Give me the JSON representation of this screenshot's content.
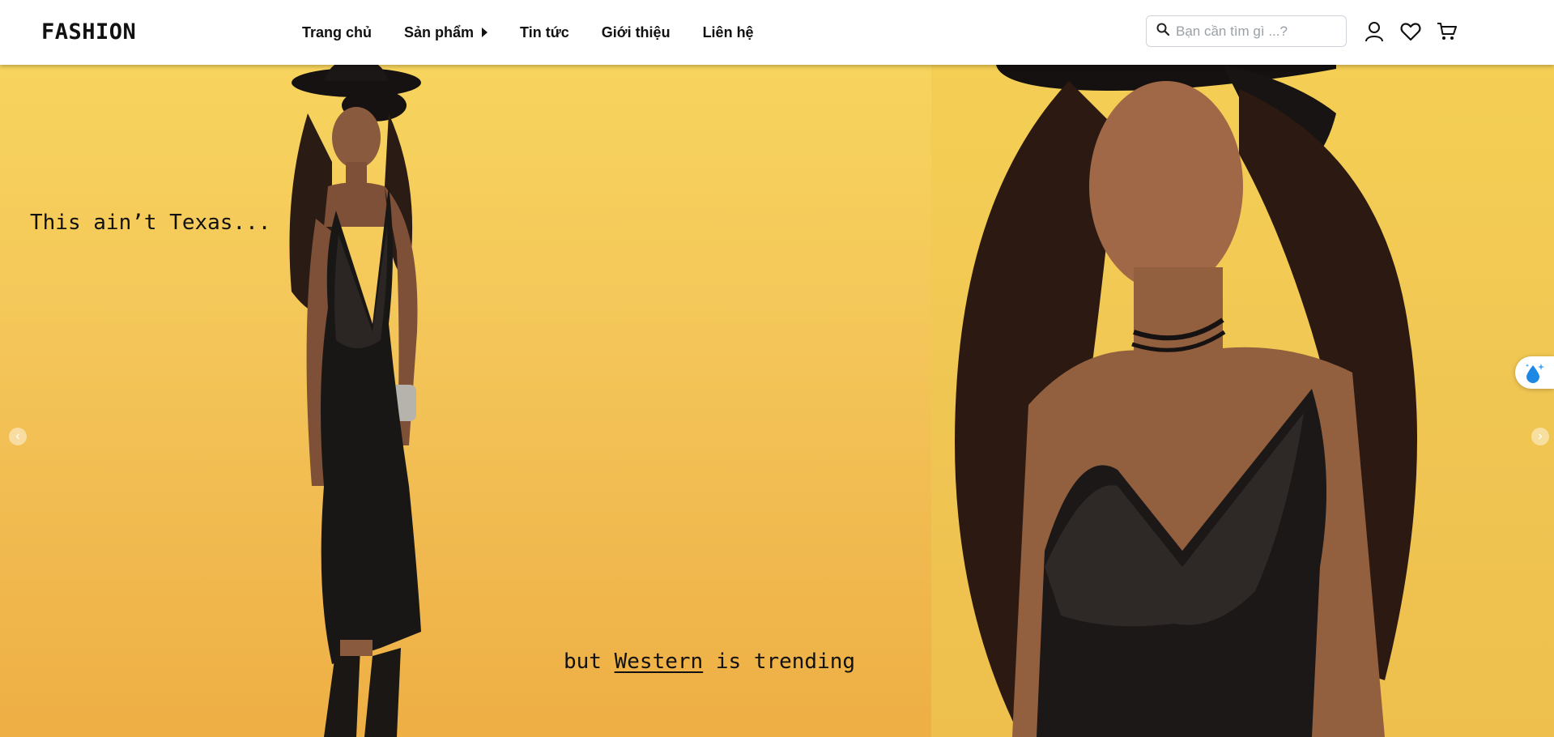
{
  "header": {
    "logo": "FASHION",
    "nav": [
      {
        "label": "Trang chủ"
      },
      {
        "label": "Sản phẩm"
      },
      {
        "label": "Tin tức"
      },
      {
        "label": "Giới thiệu"
      },
      {
        "label": "Liên hệ"
      }
    ],
    "search": {
      "placeholder": "Bạn cần tìm gì ...?",
      "value": ""
    },
    "icons": [
      "search-icon",
      "user-icon",
      "heart-icon",
      "cart-icon"
    ]
  },
  "banner": {
    "caption_top": "This ain’t Texas...",
    "caption_bottom_pre": "but ",
    "caption_bottom_link": "Western",
    "caption_bottom_post": " is trending",
    "prev_arrow": "‹",
    "next_arrow": "›"
  },
  "colors": {
    "background_yellow": "#f4c659",
    "text": "#111111",
    "floating_icon": "#1e88e5"
  }
}
